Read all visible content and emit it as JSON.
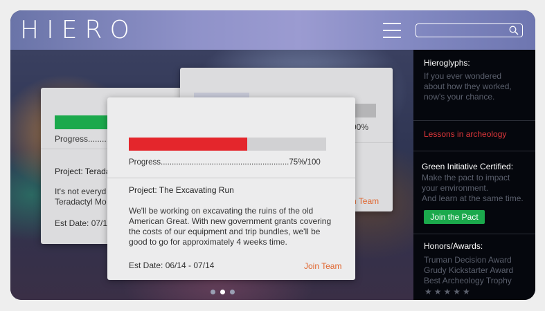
{
  "header": {
    "logo": "HIERO",
    "search": {
      "placeholder": "",
      "value": ""
    }
  },
  "cards": {
    "left": {
      "progress_label": "Progress.........",
      "progress_fraction": 0.75,
      "project_title": "Project: Terada",
      "desc_line1": "It's not everyd",
      "desc_line2": "Teradactyl Mo",
      "est_date": "Est Date: 07/14"
    },
    "right": {
      "progress_suffix": "00%",
      "join_label": "n Team"
    },
    "front": {
      "progress_label": "Progress..........................................................75%/100",
      "progress_fraction": 0.6,
      "project_title": "Project: The Excavating Run",
      "desc_lines": [
        "We'll be working on excavating the ruins of the old",
        "American Great. With new government grants covering",
        "the costs of our equipment and trip bundles, we'll be",
        "good to go for approximately 4 weeks time."
      ],
      "est_date": "Est Date: 06/14 -  07/14",
      "join_label": "Join Team"
    }
  },
  "carousel": {
    "dots": 3,
    "active_index": 1
  },
  "sidebar": {
    "hieroglyphs": {
      "title": "Hieroglyphs:",
      "lines": [
        "If you ever wondered",
        "about how they worked,",
        "now's your chance."
      ]
    },
    "lessons": {
      "label": "Lessons in archeology"
    },
    "green": {
      "title": "Green Initiative Certified:",
      "lines": [
        "Make the pact to impact",
        "your environment.",
        "And learn at the same time."
      ],
      "button_label": "Join the Pact"
    },
    "honors": {
      "title": "Honors/Awards:",
      "items": [
        "Truman Decision Award",
        "Grudy Kickstarter Award",
        "Best Archeology Trophy"
      ],
      "stars": "★★★★★"
    }
  },
  "colors": {
    "accent_red": "#e4262c",
    "accent_green": "#1ba94c",
    "join_orange": "#e0652e",
    "lessons_red": "#e0373a"
  }
}
